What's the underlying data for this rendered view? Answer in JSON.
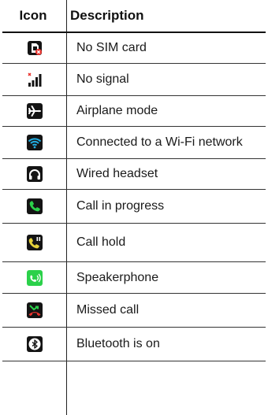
{
  "table": {
    "headers": {
      "icon": "Icon",
      "description": "Description"
    },
    "rows": [
      {
        "icon": "no-sim-card-icon",
        "description": "No SIM card"
      },
      {
        "icon": "no-signal-icon",
        "description": "No signal"
      },
      {
        "icon": "airplane-mode-icon",
        "description": "Airplane mode"
      },
      {
        "icon": "wifi-icon",
        "description": "Connected to a Wi-Fi network"
      },
      {
        "icon": "wired-headset-icon",
        "description": "Wired headset"
      },
      {
        "icon": "call-in-progress-icon",
        "description": "Call in progress"
      },
      {
        "icon": "call-hold-icon",
        "description": "Call hold"
      },
      {
        "icon": "speakerphone-icon",
        "description": "Speakerphone"
      },
      {
        "icon": "missed-call-icon",
        "description": "Missed call"
      },
      {
        "icon": "bluetooth-icon",
        "description": "Bluetooth is on"
      }
    ]
  },
  "colors": {
    "icon_background": "#141414",
    "green": "#2bd14a",
    "wifi_blue": "#22aee3",
    "red": "#e8322d"
  }
}
